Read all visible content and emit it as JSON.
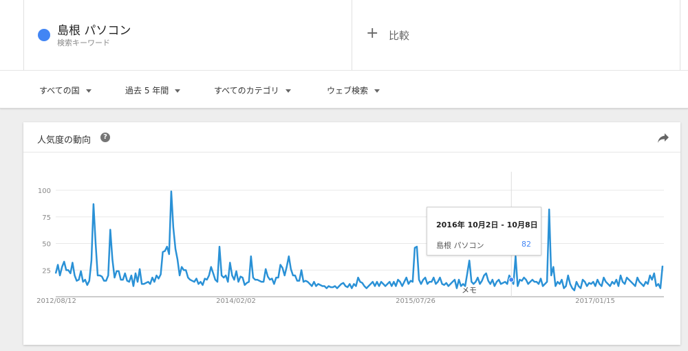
{
  "search_term": {
    "name": "島根 パソコン",
    "subtitle": "検索キーワード",
    "color": "#4285f4"
  },
  "compare": {
    "icon": "plus-icon",
    "label": "比較"
  },
  "filters": [
    {
      "label": "すべての国"
    },
    {
      "label": "過去 5 年間"
    },
    {
      "label": "すべてのカテゴリ"
    },
    {
      "label": "ウェブ検索"
    }
  ],
  "card": {
    "title": "人気度の動向",
    "help_icon": "help-icon",
    "help_glyph": "?",
    "share_icon": "share-icon"
  },
  "tooltip": {
    "date": "2016年 10月2日 - 10月8日",
    "series": "島根 パソコン",
    "value": "82"
  },
  "chart_data": {
    "type": "line",
    "ylim": [
      0,
      100
    ],
    "yticks": [
      25,
      50,
      75,
      100
    ],
    "x_tick_labels": [
      "2012/08/12",
      "2014/02/02",
      "2015/07/26",
      "2017/01/15"
    ],
    "annotation": "メモ",
    "grid": true,
    "color": "#4285f4",
    "highlight_index": 217,
    "series": [
      {
        "values": [
          22,
          30,
          20,
          28,
          33,
          25,
          25,
          22,
          32,
          20,
          15,
          16,
          24,
          14,
          16,
          11,
          15,
          34,
          87,
          50,
          20,
          20,
          19,
          15,
          15,
          20,
          63,
          35,
          18,
          24,
          24,
          16,
          16,
          22,
          15,
          14,
          20,
          10,
          22,
          14,
          26,
          12,
          12,
          13,
          14,
          12,
          18,
          14,
          20,
          17,
          21,
          42,
          43,
          47,
          40,
          99,
          65,
          45,
          35,
          20,
          28,
          25,
          25,
          18,
          16,
          15,
          14,
          17,
          12,
          14,
          11,
          17,
          16,
          20,
          28,
          22,
          16,
          14,
          47,
          20,
          18,
          20,
          14,
          32,
          20,
          16,
          24,
          14,
          19,
          18,
          11,
          13,
          14,
          38,
          18,
          16,
          16,
          15,
          14,
          14,
          26,
          19,
          16,
          17,
          12,
          18,
          18,
          30,
          27,
          20,
          28,
          38,
          26,
          20,
          20,
          15,
          15,
          25,
          14,
          15,
          14,
          12,
          10,
          14,
          10,
          12,
          11,
          10,
          10,
          8,
          10,
          9,
          9,
          10,
          8,
          10,
          12,
          13,
          10,
          9,
          12,
          8,
          12,
          10,
          18,
          14,
          13,
          10,
          8,
          10,
          12,
          14,
          10,
          14,
          10,
          14,
          12,
          10,
          12,
          14,
          10,
          14,
          10,
          16,
          14,
          10,
          14,
          18,
          12,
          15,
          14,
          46,
          47,
          16,
          12,
          16,
          18,
          12,
          14,
          14,
          18,
          12,
          14,
          18,
          12,
          11,
          13,
          10,
          12,
          14,
          16,
          8,
          16,
          10,
          12,
          10,
          22,
          34,
          14,
          12,
          14,
          18,
          12,
          15,
          20,
          22,
          15,
          12,
          16,
          10,
          14,
          16,
          12,
          13,
          14,
          12,
          20,
          16,
          12,
          38,
          10,
          16,
          15,
          18,
          16,
          12,
          14,
          16,
          14,
          14,
          12,
          17,
          10,
          12,
          14,
          82,
          20,
          28,
          10,
          14,
          12,
          16,
          8,
          10,
          20,
          12,
          8,
          6,
          14,
          10,
          8,
          16,
          14,
          10,
          13,
          12,
          14,
          10,
          16,
          12,
          10,
          18,
          14,
          12,
          10,
          14,
          12,
          16,
          10,
          20,
          14,
          12,
          18,
          16,
          14,
          12,
          10,
          18,
          14,
          12,
          10,
          14,
          12,
          20,
          16,
          22,
          10,
          12,
          8,
          29
        ]
      }
    ]
  }
}
